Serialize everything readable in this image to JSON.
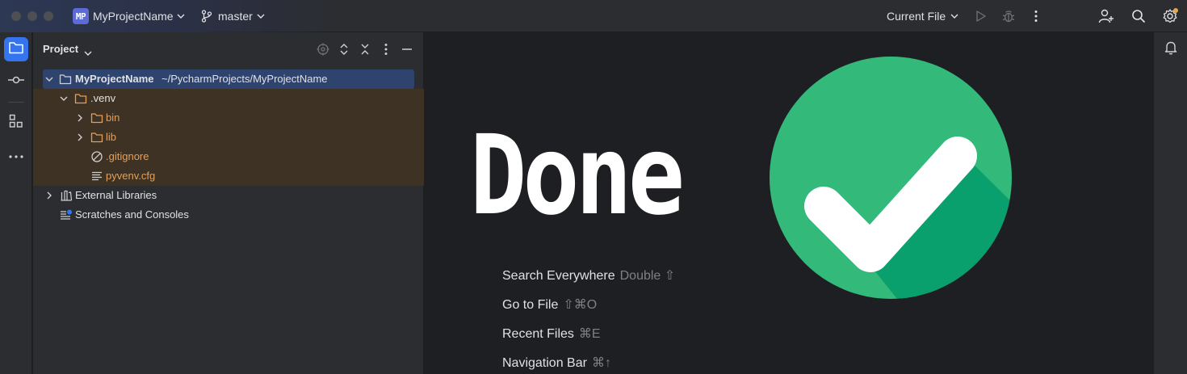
{
  "titlebar": {
    "project_badge": "MP",
    "project_name": "MyProjectName",
    "branch": "master",
    "run_config": "Current File",
    "icons": [
      "chevron-down-icon",
      "branch-icon",
      "run-icon",
      "debug-icon",
      "more-icon",
      "add-user-icon",
      "search-icon",
      "settings-icon"
    ]
  },
  "toolstrip": {
    "items": [
      {
        "name": "project",
        "icon": "folder-icon",
        "active": true
      },
      {
        "name": "commit",
        "icon": "commit-icon",
        "active": false
      },
      {
        "name": "structure",
        "icon": "structure-icon",
        "active": false
      },
      {
        "name": "more",
        "icon": "more-horizontal-icon",
        "active": false
      }
    ]
  },
  "project_panel": {
    "title": "Project",
    "tree": [
      {
        "label": "MyProjectName",
        "path": "~/PycharmProjects/MyProjectName",
        "type": "folder",
        "expanded": true,
        "depth": 0
      },
      {
        "label": ".venv",
        "type": "folder",
        "expanded": true,
        "depth": 1
      },
      {
        "label": "bin",
        "type": "folder",
        "expanded": false,
        "depth": 2
      },
      {
        "label": "lib",
        "type": "folder",
        "expanded": false,
        "depth": 2
      },
      {
        "label": ".gitignore",
        "type": "ignore-file",
        "depth": 2
      },
      {
        "label": "pyvenv.cfg",
        "type": "text-file",
        "depth": 2
      },
      {
        "label": "External Libraries",
        "type": "library",
        "expanded": false,
        "depth": 0
      },
      {
        "label": "Scratches and Consoles",
        "type": "scratches",
        "depth": 0
      }
    ]
  },
  "editor": {
    "overlay_text": "Done",
    "shortcuts": [
      {
        "name": "Search Everywhere",
        "key": "Double ⇧"
      },
      {
        "name": "Go to File",
        "key": "⇧⌘O"
      },
      {
        "name": "Recent Files",
        "key": "⌘E"
      },
      {
        "name": "Navigation Bar",
        "key": "⌘↑"
      }
    ]
  },
  "colors": {
    "accent": "#3574f0",
    "check_green": "#33b97a",
    "check_shadow": "#0aa06e",
    "venv_highlight": "#3d3223",
    "excluded_orange": "#e59f59",
    "selection": "#2e436e"
  }
}
